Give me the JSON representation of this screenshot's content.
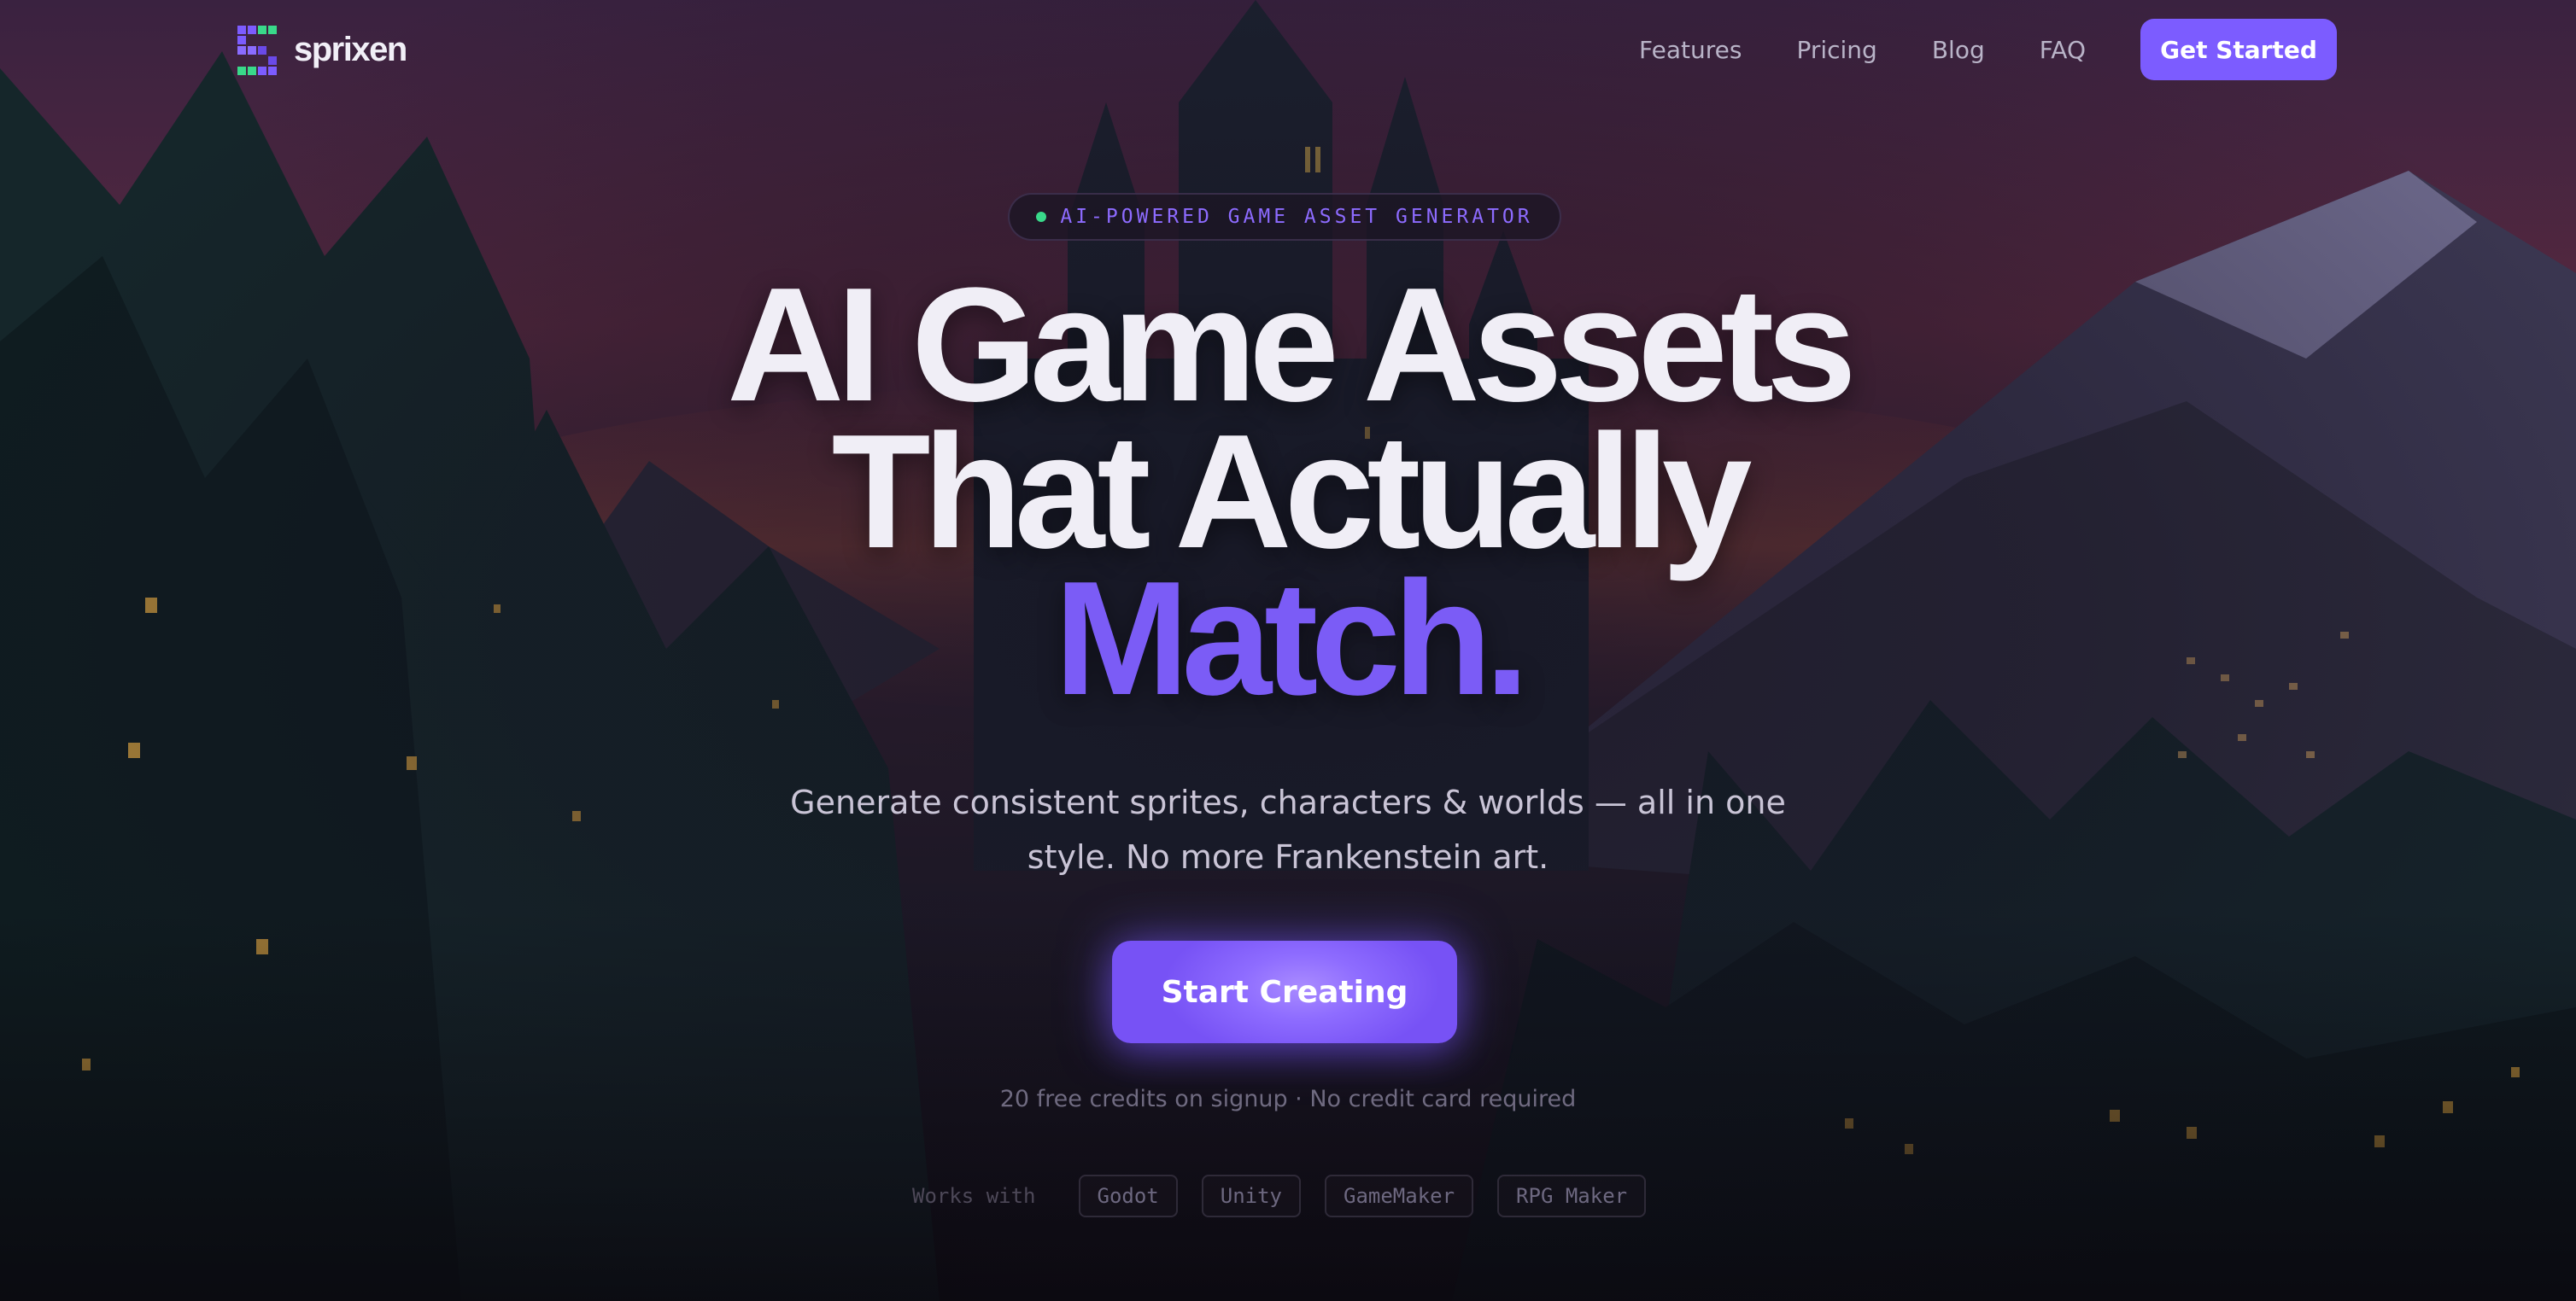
{
  "brand": {
    "name": "sprixen"
  },
  "nav": {
    "links": [
      "Features",
      "Pricing",
      "Blog",
      "FAQ"
    ],
    "cta": "Get Started"
  },
  "hero": {
    "badge": "AI-POWERED GAME ASSET GENERATOR",
    "headline": [
      "AI Game Assets",
      "That Actually",
      "Match."
    ],
    "subtitle": "Generate consistent sprites, characters & worlds — all in one style. No more Frankenstein art.",
    "cta": "Start Creating",
    "note": "20 free credits on signup · No credit card required"
  },
  "integrations": {
    "label": "Works with",
    "engines": [
      "Godot",
      "Unity",
      "GameMaker",
      "RPG Maker"
    ]
  },
  "colors": {
    "accent": "#7c5cff",
    "headline": "#f0eef6",
    "badge_dot": "#39d98a",
    "background": "#14121c"
  },
  "icons": {
    "logo": "pixel-s-logo-icon",
    "badge": "status-dot-icon"
  }
}
